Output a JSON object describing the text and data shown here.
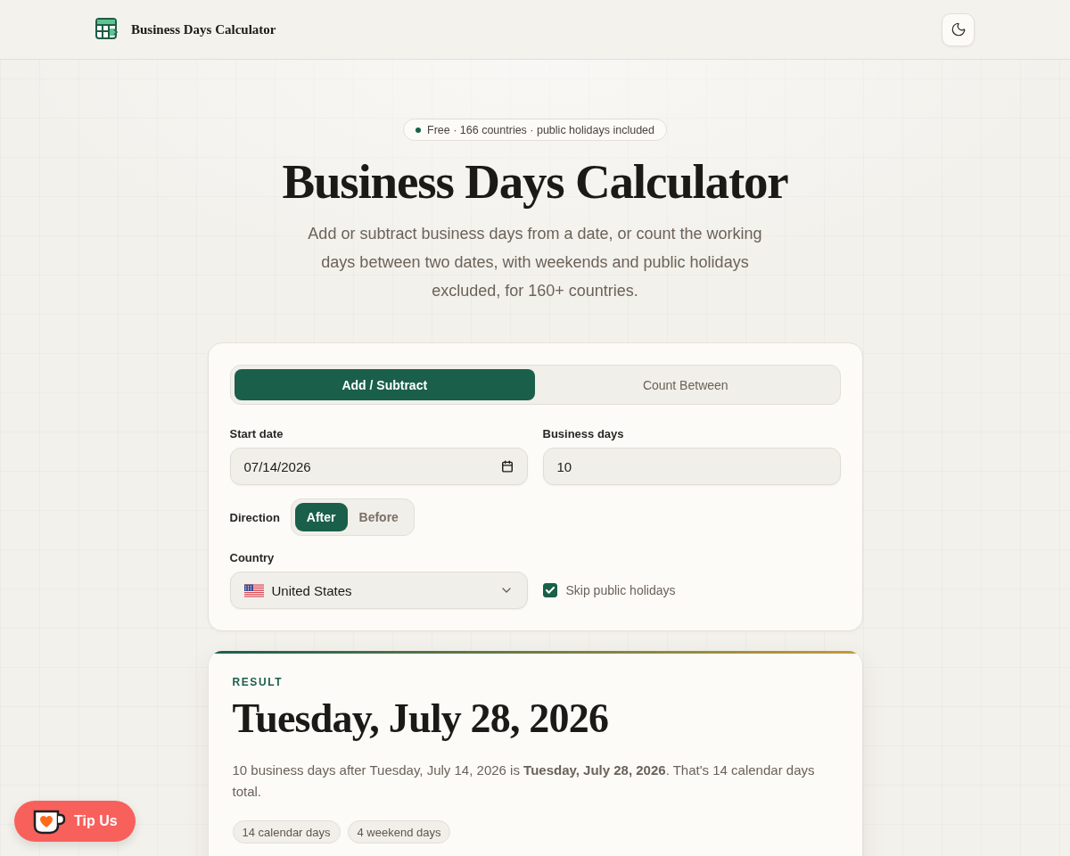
{
  "header": {
    "title": "Business Days Calculator"
  },
  "hero": {
    "badge": "Free · 166 countries · public holidays included",
    "title": "Business Days Calculator",
    "subtitle": "Add or subtract business days from a date, or count the working days between two dates, with weekends and public holidays excluded, for 160+ countries."
  },
  "calculator": {
    "tabs": [
      {
        "label": "Add / Subtract",
        "selected": true
      },
      {
        "label": "Count Between",
        "selected": false
      }
    ],
    "start_date": {
      "label": "Start date",
      "value": "07/14/2026"
    },
    "business_days": {
      "label": "Business days",
      "value": "10"
    },
    "direction": {
      "label": "Direction",
      "options": [
        {
          "label": "After",
          "selected": true
        },
        {
          "label": "Before",
          "selected": false
        }
      ]
    },
    "country": {
      "label": "Country",
      "value": "United States"
    },
    "skip_holidays": {
      "label": "Skip public holidays",
      "checked": true
    }
  },
  "result": {
    "label": "RESULT",
    "date": "Tuesday, July 28, 2026",
    "summary": "10 business days after Tuesday, July 14, 2026 is **Tuesday, July 28, 2026**. That's 14 calendar days total.",
    "chips": [
      "14 calendar days",
      "4 weekend days"
    ]
  },
  "tip_button": {
    "label": "Tip Us"
  }
}
